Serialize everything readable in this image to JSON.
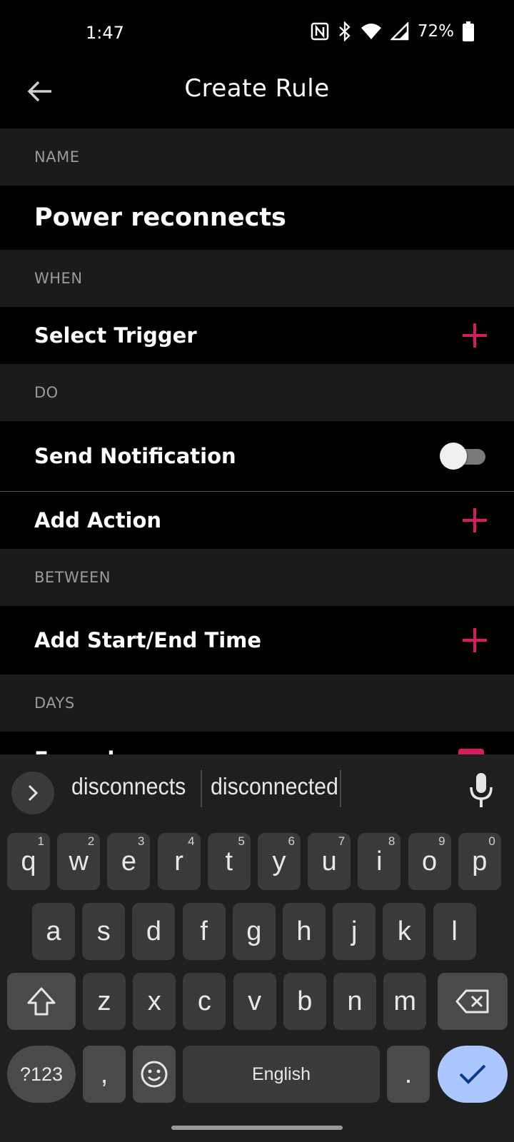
{
  "status_bar": {
    "time": "1:47",
    "battery": "72%"
  },
  "app_bar": {
    "title": "Create Rule"
  },
  "form": {
    "name_header": "NAME",
    "name_value": "Power reconnects",
    "when_header": "WHEN",
    "select_trigger": "Select Trigger",
    "do_header": "DO",
    "send_notification": "Send Notification",
    "send_notification_on": false,
    "add_action": "Add Action",
    "between_header": "BETWEEN",
    "add_time": "Add Start/End Time",
    "days_header": "DAYS",
    "days_row_partial": "Everyday"
  },
  "colors": {
    "accent": "#d81b60",
    "section_bg": "#1b1b1c",
    "enter_key": "#aac7ff"
  },
  "keyboard": {
    "suggestions": [
      "disconnects",
      "disconnected"
    ],
    "row1": [
      {
        "k": "q",
        "h": "1"
      },
      {
        "k": "w",
        "h": "2"
      },
      {
        "k": "e",
        "h": "3"
      },
      {
        "k": "r",
        "h": "4"
      },
      {
        "k": "t",
        "h": "5"
      },
      {
        "k": "y",
        "h": "6"
      },
      {
        "k": "u",
        "h": "7"
      },
      {
        "k": "i",
        "h": "8"
      },
      {
        "k": "o",
        "h": "9"
      },
      {
        "k": "p",
        "h": "0"
      }
    ],
    "row2": [
      "a",
      "s",
      "d",
      "f",
      "g",
      "h",
      "j",
      "k",
      "l"
    ],
    "row3": [
      "z",
      "x",
      "c",
      "v",
      "b",
      "n",
      "m"
    ],
    "num_key": "?123",
    "comma_key": ",",
    "space_label": "English",
    "period_key": "."
  }
}
